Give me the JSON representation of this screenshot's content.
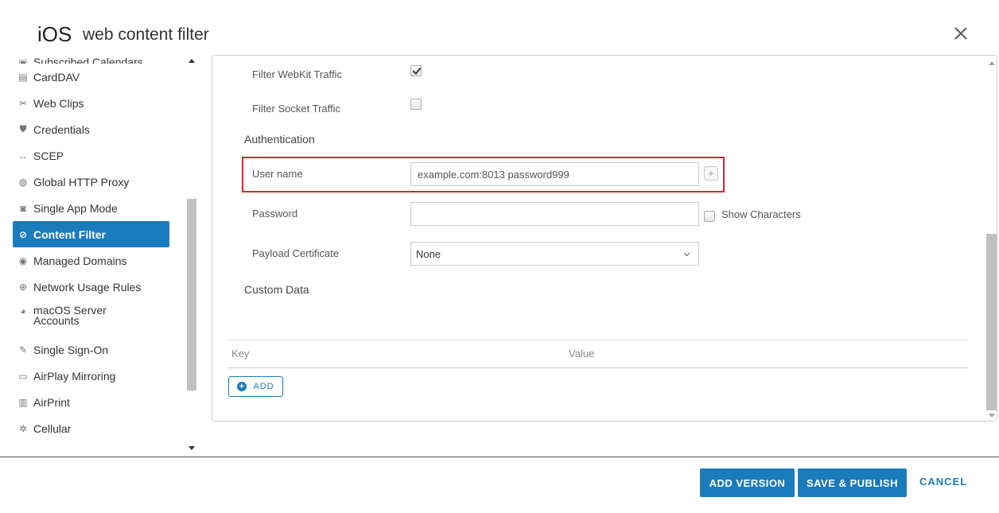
{
  "header": {
    "platform": "iOS",
    "title": "web content filter"
  },
  "sidebar": {
    "items": [
      {
        "label": "Subscribed Calendars",
        "icon": "calendar-add-icon"
      },
      {
        "label": "CardDAV",
        "icon": "contact-card-icon"
      },
      {
        "label": "Web Clips",
        "icon": "scissors-icon"
      },
      {
        "label": "Credentials",
        "icon": "shield-icon"
      },
      {
        "label": "SCEP",
        "icon": "arrows-icon"
      },
      {
        "label": "Global HTTP Proxy",
        "icon": "globe-icon"
      },
      {
        "label": "Single App Mode",
        "icon": "lock-icon"
      },
      {
        "label": "Content Filter",
        "icon": "compass-icon",
        "active": true
      },
      {
        "label": "Managed Domains",
        "icon": "globe-lock-icon"
      },
      {
        "label": "Network Usage Rules",
        "icon": "network-icon"
      },
      {
        "label": "macOS Server Accounts",
        "line1": "macOS Server",
        "line2": "Accounts",
        "icon": "server-globe-icon"
      },
      {
        "label": "Single Sign-On",
        "icon": "edit-icon"
      },
      {
        "label": "AirPlay Mirroring",
        "icon": "airplay-icon"
      },
      {
        "label": "AirPrint",
        "icon": "printer-icon"
      },
      {
        "label": "Cellular",
        "icon": "gear-icon"
      }
    ]
  },
  "form": {
    "filter_webkit_label": "Filter WebKit Traffic",
    "filter_webkit_checked": true,
    "filter_socket_label": "Filter Socket Traffic",
    "filter_socket_checked": false,
    "authentication_title": "Authentication",
    "username_label": "User name",
    "username_value": "example.com:8013 password999",
    "password_label": "Password",
    "password_value": "",
    "show_characters_label": "Show Characters",
    "payload_certificate_label": "Payload Certificate",
    "payload_certificate_value": "None",
    "custom_data_title": "Custom Data",
    "table_headers": {
      "key": "Key",
      "value": "Value"
    },
    "add_label": "ADD"
  },
  "footer": {
    "add_version": "ADD VERSION",
    "save_publish": "SAVE & PUBLISH",
    "cancel": "CANCEL"
  },
  "colors": {
    "accent": "#1a7bbd",
    "highlight": "#d9262f"
  }
}
